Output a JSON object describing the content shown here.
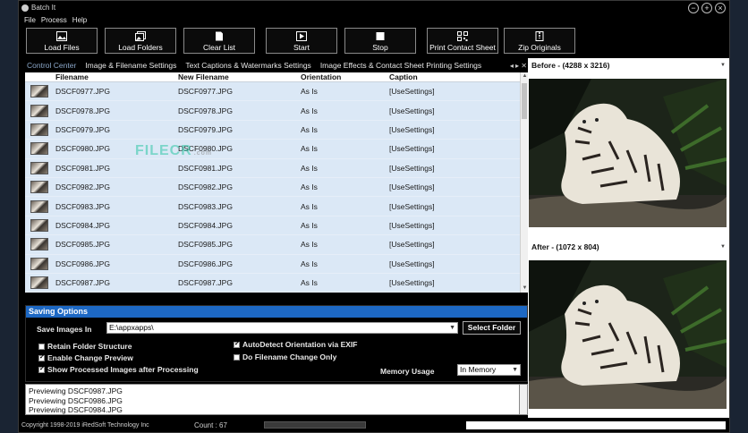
{
  "window": {
    "title": "Batch It"
  },
  "menu": [
    "File",
    "Process",
    "Help"
  ],
  "toolbar": {
    "buttons": [
      {
        "label": "Load Files",
        "icon": "image-icon"
      },
      {
        "label": "Load Folders",
        "icon": "folder-images-icon"
      },
      {
        "label": "Clear List",
        "icon": "document-icon"
      },
      {
        "label": "Start",
        "icon": "play-icon"
      },
      {
        "label": "Stop",
        "icon": "stop-icon"
      },
      {
        "label": "Print Contact Sheet",
        "icon": "qr-icon"
      },
      {
        "label": "Zip Originals",
        "icon": "zip-icon"
      }
    ]
  },
  "tabs": [
    "Control Center",
    "Image & Filename Settings",
    "Text Captions & Watermarks Settings",
    "Image Effects & Contact Sheet Printing Settings"
  ],
  "grid": {
    "headers": {
      "filename": "Filename",
      "new_filename": "New Filename",
      "orientation": "Orientation",
      "caption": "Caption"
    },
    "rows": [
      {
        "filename": "DSCF0977.JPG",
        "new_filename": "DSCF0977.JPG",
        "orientation": "As Is",
        "caption": "[UseSettings]"
      },
      {
        "filename": "DSCF0978.JPG",
        "new_filename": "DSCF0978.JPG",
        "orientation": "As Is",
        "caption": "[UseSettings]"
      },
      {
        "filename": "DSCF0979.JPG",
        "new_filename": "DSCF0979.JPG",
        "orientation": "As Is",
        "caption": "[UseSettings]"
      },
      {
        "filename": "DSCF0980.JPG",
        "new_filename": "DSCF0980.JPG",
        "orientation": "As Is",
        "caption": "[UseSettings]"
      },
      {
        "filename": "DSCF0981.JPG",
        "new_filename": "DSCF0981.JPG",
        "orientation": "As Is",
        "caption": "[UseSettings]"
      },
      {
        "filename": "DSCF0982.JPG",
        "new_filename": "DSCF0982.JPG",
        "orientation": "As Is",
        "caption": "[UseSettings]"
      },
      {
        "filename": "DSCF0983.JPG",
        "new_filename": "DSCF0983.JPG",
        "orientation": "As Is",
        "caption": "[UseSettings]"
      },
      {
        "filename": "DSCF0984.JPG",
        "new_filename": "DSCF0984.JPG",
        "orientation": "As Is",
        "caption": "[UseSettings]"
      },
      {
        "filename": "DSCF0985.JPG",
        "new_filename": "DSCF0985.JPG",
        "orientation": "As Is",
        "caption": "[UseSettings]"
      },
      {
        "filename": "DSCF0986.JPG",
        "new_filename": "DSCF0986.JPG",
        "orientation": "As Is",
        "caption": "[UseSettings]"
      },
      {
        "filename": "DSCF0987.JPG",
        "new_filename": "DSCF0987.JPG",
        "orientation": "As Is",
        "caption": "[UseSettings]"
      }
    ]
  },
  "watermark": {
    "text": "FILECR",
    "sub": ".com"
  },
  "saving": {
    "title": "Saving Options",
    "save_images_in_label": "Save Images In",
    "path": "E:\\appxapps\\",
    "select_folder_label": "Select Folder",
    "retain_folder_structure": {
      "label": "Retain Folder Structure",
      "checked": false
    },
    "enable_change_preview": {
      "label": "Enable Change Preview",
      "checked": true
    },
    "show_processed_images": {
      "label": "Show Processed Images after Processing",
      "checked": true
    },
    "auto_detect_orientation": {
      "label": "AutoDetect Orientation via EXIF",
      "checked": true
    },
    "do_filename_change_only": {
      "label": "Do Filename Change Only",
      "checked": false
    },
    "memory_usage_label": "Memory Usage",
    "memory_usage_value": "In Memory"
  },
  "log": [
    "Previewing DSCF0987.JPG",
    "Previewing DSCF0986.JPG",
    "Previewing DSCF0984.JPG"
  ],
  "status": {
    "copyright": "Copyright 1998-2019 iRedSoft Technology Inc",
    "count": "Count : 67"
  },
  "preview": {
    "before_label": "Before - (4288 x 3216)",
    "after_label": "After - (1072 x 804)"
  },
  "colors": {
    "accent": "#1d68c4",
    "grid_bg": "#dbe8f6"
  }
}
